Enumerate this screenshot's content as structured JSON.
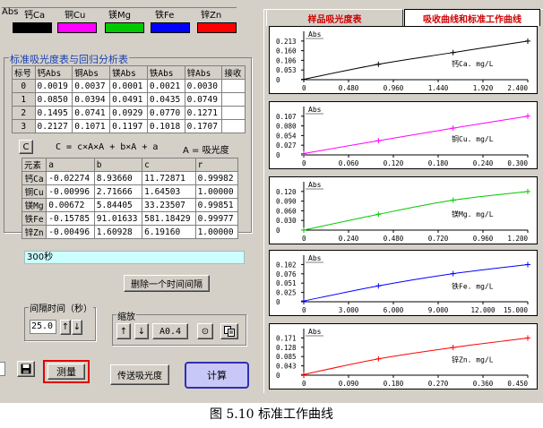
{
  "legend": {
    "title": "Abs",
    "items": [
      {
        "label": "钙Ca",
        "color": "#000000"
      },
      {
        "label": "铜Cu",
        "color": "#ff00ff"
      },
      {
        "label": "镁Mg",
        "color": "#00c800"
      },
      {
        "label": "铁Fe",
        "color": "#0000ff"
      },
      {
        "label": "锌Zn",
        "color": "#ff0000"
      }
    ]
  },
  "std_table": {
    "title": "标准吸光度表与回归分析表",
    "headers": [
      "标号",
      "钙Abs",
      "铜Abs",
      "镁Abs",
      "铁Abs",
      "锌Abs",
      "接收"
    ],
    "rows": [
      [
        "0",
        "0.0019",
        "0.0037",
        "0.0001",
        "0.0021",
        "0.0030",
        ""
      ],
      [
        "1",
        "0.0850",
        "0.0394",
        "0.0491",
        "0.0435",
        "0.0749",
        ""
      ],
      [
        "2",
        "0.1495",
        "0.0741",
        "0.0929",
        "0.0770",
        "0.1271",
        ""
      ],
      [
        "3",
        "0.2127",
        "0.1071",
        "0.1197",
        "0.1018",
        "0.1707",
        ""
      ]
    ]
  },
  "regression": {
    "c_button": "C",
    "formula": "C = c×A×A + b×A + a",
    "note": "A = 吸光度",
    "headers": [
      "元素",
      "a",
      "b",
      "c",
      "r"
    ],
    "rows": [
      [
        "钙Ca",
        "-0.02274",
        "8.93660",
        "11.72871",
        "0.99982"
      ],
      [
        "铜Cu",
        "-0.00996",
        "2.71666",
        "1.64503",
        "1.00000"
      ],
      [
        "镁Mg",
        "0.00672",
        "5.84405",
        "33.23507",
        "0.99851"
      ],
      [
        "铁Fe",
        "-0.15785",
        "91.01633",
        "581.18429",
        "0.99977"
      ],
      [
        "锌Zn",
        "-0.00496",
        "1.60928",
        "6.19160",
        "1.00000"
      ]
    ]
  },
  "status_text": "300秒",
  "delete_interval_button": "删除一个时间间隔",
  "interval": {
    "title": "间隔时间（秒）",
    "value": "25.0",
    "up": "↑",
    "down": "↓"
  },
  "zoom": {
    "title": "缩放",
    "up": "↑",
    "down": "↓",
    "value": "A0.4",
    "target": "⊙"
  },
  "buttons": {
    "measure": "测量",
    "send": "传送吸光度",
    "calc": "计算"
  },
  "tabs": [
    "样品吸光度表",
    "吸收曲线和标准工作曲线"
  ],
  "caption": "图 5.10  标准工作曲线",
  "chart_data": [
    {
      "type": "line",
      "ylabel": "Abs",
      "xlabel": "钙Ca. mg/L",
      "color": "#000000",
      "xlim": [
        0,
        2.4
      ],
      "ylim": [
        0,
        0.2663
      ],
      "xticks": [
        "0",
        "0.480",
        "0.960",
        "1.440",
        "1.920",
        "2.400"
      ],
      "yticks": [
        "0.213",
        "0.160",
        "0.106",
        "0.053",
        "0"
      ],
      "points": [
        [
          0,
          0.0019
        ],
        [
          0.8,
          0.085
        ],
        [
          1.6,
          0.1495
        ],
        [
          2.4,
          0.2127
        ]
      ]
    },
    {
      "type": "line",
      "ylabel": "Abs",
      "xlabel": "铜Cu. mg/L",
      "color": "#ff00ff",
      "xlim": [
        0,
        0.3
      ],
      "ylim": [
        0,
        0.1338
      ],
      "xticks": [
        "0",
        "0.060",
        "0.120",
        "0.180",
        "0.240",
        "0.300"
      ],
      "yticks": [
        "0.107",
        "0.080",
        "0.054",
        "0.027",
        "0"
      ],
      "points": [
        [
          0,
          0.0037
        ],
        [
          0.1,
          0.0394
        ],
        [
          0.2,
          0.0741
        ],
        [
          0.3,
          0.1071
        ]
      ]
    },
    {
      "type": "line",
      "ylabel": "Abs",
      "xlabel": "镁Mg. mg/L",
      "color": "#00c800",
      "xlim": [
        0,
        1.2
      ],
      "ylim": [
        0,
        0.15
      ],
      "xticks": [
        "0",
        "0.240",
        "0.480",
        "0.720",
        "0.960",
        "1.200"
      ],
      "yticks": [
        "0.120",
        "0.090",
        "0.060",
        "0.030",
        "0"
      ],
      "points": [
        [
          0,
          0.0001
        ],
        [
          0.4,
          0.0491
        ],
        [
          0.8,
          0.0929
        ],
        [
          1.2,
          0.1197
        ]
      ]
    },
    {
      "type": "line",
      "ylabel": "Abs",
      "xlabel": "铁Fe. mg/L",
      "color": "#0000ff",
      "xlim": [
        0,
        15
      ],
      "ylim": [
        0,
        0.1275
      ],
      "xticks": [
        "0",
        "3.000",
        "6.000",
        "9.000",
        "12.000",
        "15.000"
      ],
      "yticks": [
        "0.102",
        "0.076",
        "0.051",
        "0.025",
        "0"
      ],
      "points": [
        [
          0,
          0.0021
        ],
        [
          5,
          0.0435
        ],
        [
          10,
          0.077
        ],
        [
          15,
          0.1018
        ]
      ]
    },
    {
      "type": "line",
      "ylabel": "Abs",
      "xlabel": "锌Zn. mg/L",
      "color": "#ff0000",
      "xlim": [
        0,
        0.45
      ],
      "ylim": [
        0,
        0.2138
      ],
      "xticks": [
        "0",
        "0.090",
        "0.180",
        "0.270",
        "0.360",
        "0.450"
      ],
      "yticks": [
        "0.171",
        "0.128",
        "0.085",
        "0.043",
        "0"
      ],
      "points": [
        [
          0,
          0.003
        ],
        [
          0.15,
          0.0749
        ],
        [
          0.3,
          0.1271
        ],
        [
          0.45,
          0.1707
        ]
      ]
    }
  ]
}
